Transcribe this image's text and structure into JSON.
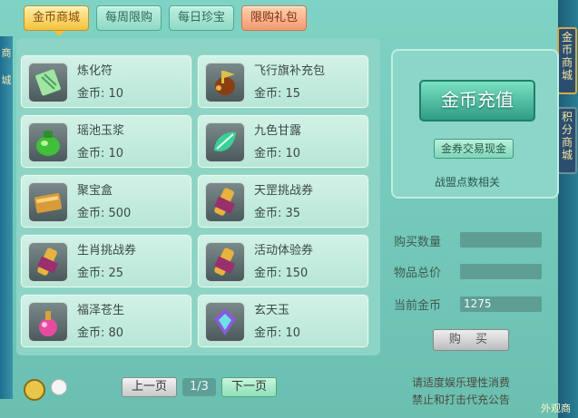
{
  "tabs": [
    {
      "label": "金币商城",
      "active": true
    },
    {
      "label": "每周限购",
      "active": false
    },
    {
      "label": "每日珍宝",
      "active": false
    },
    {
      "label": "限购礼包",
      "active": false
    }
  ],
  "items": [
    {
      "name": "炼化符",
      "price": "金币: 10",
      "icon": "talisman-icon"
    },
    {
      "name": "飞行旗补充包",
      "price": "金币: 15",
      "icon": "flag-bag-icon"
    },
    {
      "name": "瑶池玉浆",
      "price": "金币: 10",
      "icon": "green-jar-icon"
    },
    {
      "name": "九色甘露",
      "price": "金币: 10",
      "icon": "dew-leaf-icon"
    },
    {
      "name": "聚宝盒",
      "price": "金币: 500",
      "icon": "treasure-box-icon"
    },
    {
      "name": "天罡挑战券",
      "price": "金币: 35",
      "icon": "scroll-icon"
    },
    {
      "name": "生肖挑战券",
      "price": "金币: 25",
      "icon": "scroll-icon"
    },
    {
      "name": "活动体验券",
      "price": "金币: 150",
      "icon": "scroll-icon"
    },
    {
      "name": "福泽苍生",
      "price": "金币: 80",
      "icon": "pink-bottle-icon"
    },
    {
      "name": "玄天玉",
      "price": "金币: 10",
      "icon": "jade-gem-icon"
    }
  ],
  "pager": {
    "prev": "上一页",
    "page": "1/3",
    "next": "下一页"
  },
  "side": {
    "topup": "金币充值",
    "trade": "金券交易现金",
    "alliance": "战盟点数相关"
  },
  "purchase": {
    "qty_label": "购买数量",
    "total_label": "物品总价",
    "gold_label": "当前金币",
    "gold_value": "1275",
    "buy": "购 买"
  },
  "notices": [
    "请适度娱乐理性消费",
    "禁止和打击代充公告"
  ],
  "edges": {
    "left": [
      "商",
      "城"
    ],
    "right_top": [
      "金",
      "币",
      "商",
      "城"
    ],
    "right_mid": [
      "积",
      "分",
      "商",
      "城"
    ],
    "corner": "外观商"
  }
}
